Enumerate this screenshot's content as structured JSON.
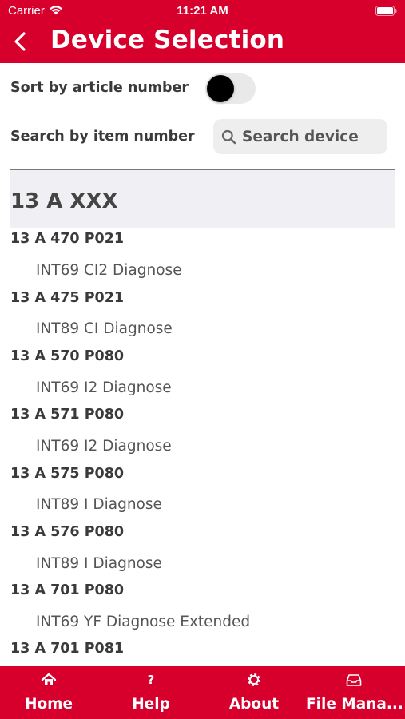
{
  "status_bar": {
    "carrier": "Carrier",
    "time": "11:21 AM"
  },
  "header": {
    "title": "Device Selection"
  },
  "sort": {
    "label": "Sort by article number",
    "enabled": false
  },
  "search": {
    "label": "Search by item number",
    "placeholder": "Search device"
  },
  "list": {
    "section_title": "13 A XXX",
    "items": [
      {
        "article": "13 A 470 P021",
        "description": "INT69 CI2 Diagnose"
      },
      {
        "article": "13 A 475 P021",
        "description": "INT89 CI Diagnose"
      },
      {
        "article": "13 A 570 P080",
        "description": "INT69 I2 Diagnose"
      },
      {
        "article": "13 A 571 P080",
        "description": "INT69 I2 Diagnose"
      },
      {
        "article": "13 A 575 P080",
        "description": "INT89 I Diagnose"
      },
      {
        "article": "13 A 576 P080",
        "description": "INT89 I Diagnose"
      },
      {
        "article": "13 A 701 P080",
        "description": "INT69 YF Diagnose Extended"
      },
      {
        "article": "13 A 701 P081",
        "description": ""
      }
    ]
  },
  "tabbar": {
    "tabs": [
      {
        "label": "Home",
        "icon": "home-icon"
      },
      {
        "label": "Help",
        "icon": "help-icon"
      },
      {
        "label": "About",
        "icon": "gear-icon"
      },
      {
        "label": "File Mana...",
        "icon": "inbox-tray-icon"
      }
    ]
  },
  "colors": {
    "brand": "#d7002d",
    "section_bg": "#efeff4",
    "search_bg": "#eeeeef"
  }
}
